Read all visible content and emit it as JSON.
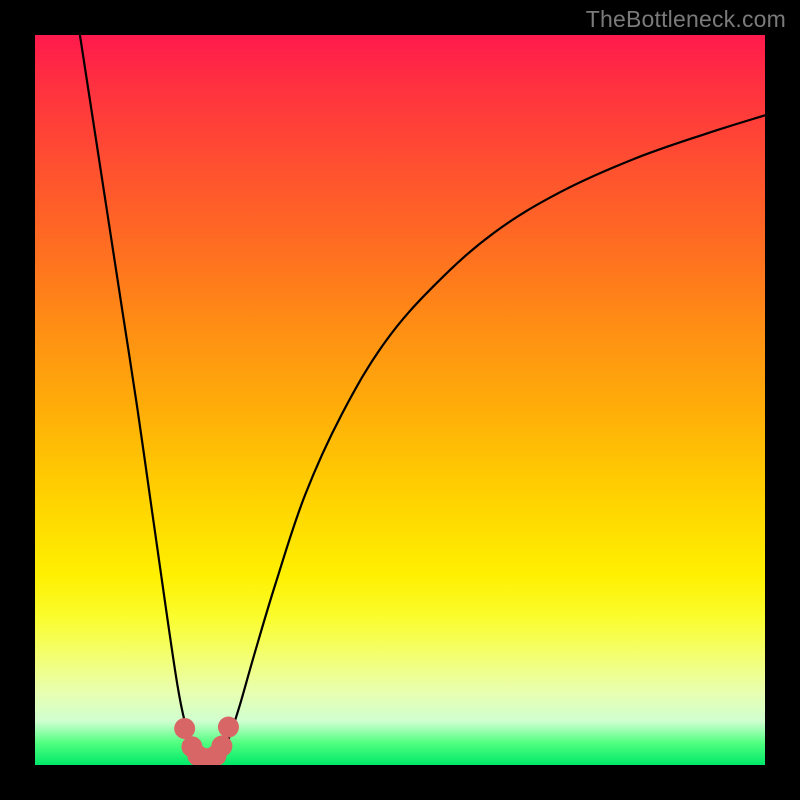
{
  "watermark": "TheBottleneck.com",
  "chart_data": {
    "type": "line",
    "title": "",
    "xlabel": "",
    "ylabel": "",
    "xlim": [
      0,
      100
    ],
    "ylim": [
      0,
      100
    ],
    "series": [
      {
        "name": "left-curve",
        "x": [
          6,
          8,
          10,
          12,
          14,
          16,
          18,
          19.5,
          20.5,
          21.5,
          22.5
        ],
        "values": [
          101,
          88,
          75,
          62,
          49,
          35,
          21,
          11,
          6,
          3,
          1.5
        ]
      },
      {
        "name": "right-curve",
        "x": [
          25.5,
          26.5,
          28,
          30,
          33,
          37,
          42,
          48,
          55,
          63,
          72,
          82,
          92,
          100
        ],
        "values": [
          1.5,
          3.5,
          8,
          15,
          25,
          37,
          48,
          58,
          66,
          73,
          78.5,
          83,
          86.5,
          89
        ]
      }
    ],
    "markers": {
      "name": "red-dots",
      "comment": "Salmon markers clustered at valley bottom",
      "x": [
        20.5,
        21.5,
        22.3,
        23.2,
        24.0,
        24.8,
        25.6,
        26.5
      ],
      "values": [
        5.0,
        2.5,
        1.3,
        0.9,
        0.9,
        1.3,
        2.6,
        5.2
      ]
    },
    "colors": {
      "curve_stroke": "#000000",
      "marker_fill": "#d96666",
      "gradient_top": "#ff1a4d",
      "gradient_bottom": "#00e868"
    }
  }
}
